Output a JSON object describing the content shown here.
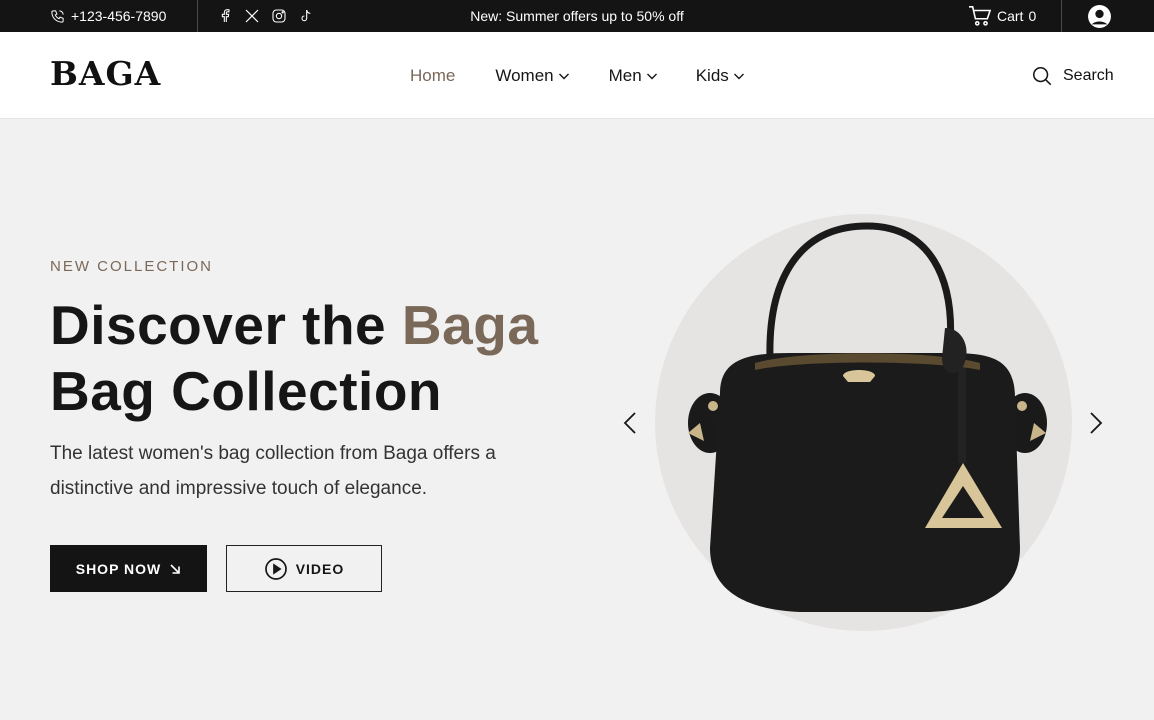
{
  "topbar": {
    "phone": "+123-456-7890",
    "promo": "New: Summer offers up to 50% off",
    "cart_label": "Cart",
    "cart_count": "0",
    "socials": [
      "facebook-icon",
      "x-icon",
      "instagram-icon",
      "tiktok-icon"
    ]
  },
  "header": {
    "logo": "BAGA",
    "nav": {
      "home": "Home",
      "women": "Women",
      "men": "Men",
      "kids": "Kids"
    },
    "search_label": "Search"
  },
  "hero": {
    "eyebrow": "NEW COLLECTION",
    "title_part1": "Discover the ",
    "title_accent": "Baga",
    "title_part2": "Bag Collection",
    "description": "The latest women's bag collection from Baga offers a distinctive and impressive touch of elegance.",
    "shop_button": "SHOP NOW",
    "video_button": "VIDEO"
  },
  "colors": {
    "accent": "#7a6858",
    "dark": "#141414",
    "background": "#f2f1f1",
    "circle": "#e6e4e3"
  }
}
